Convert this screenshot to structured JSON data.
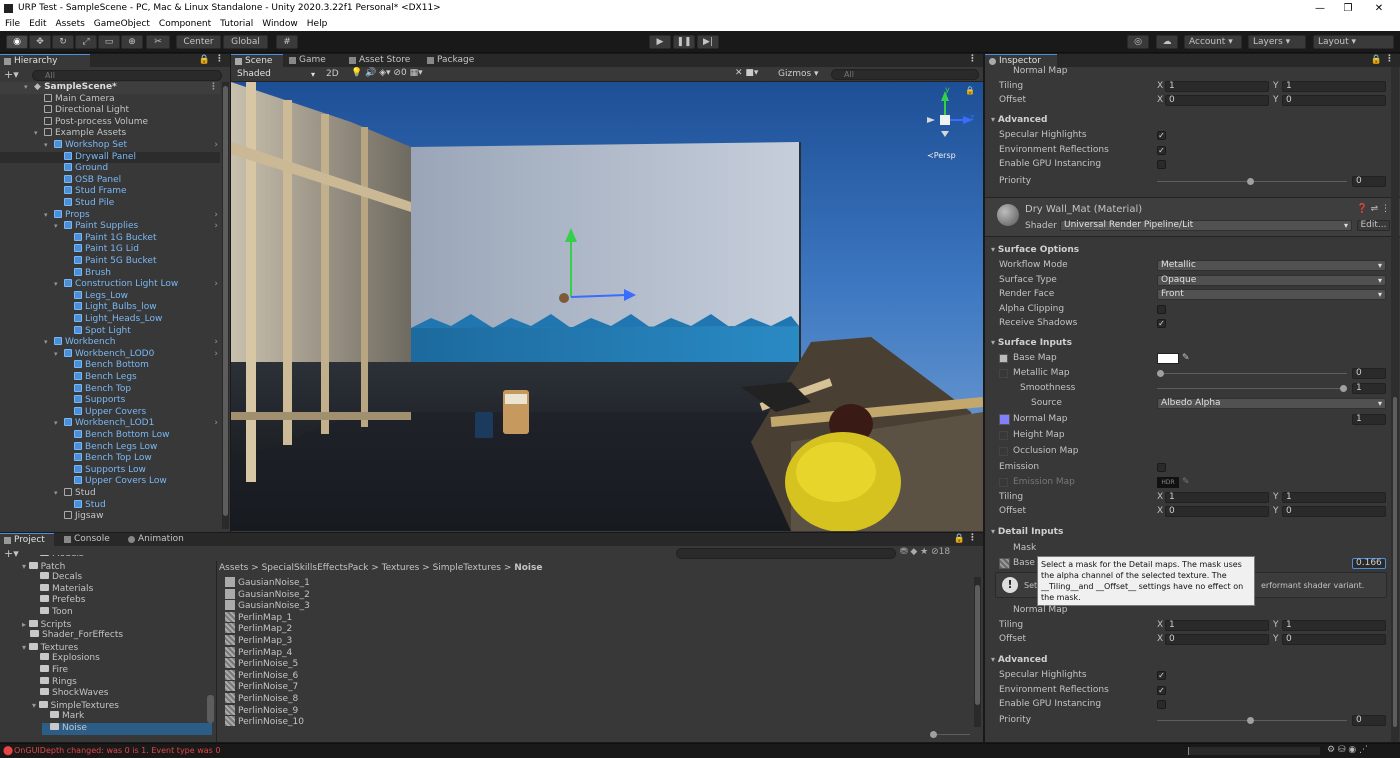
{
  "window": {
    "title": "URP Test - SampleScene - PC, Mac & Linux Standalone - Unity 2020.3.22f1 Personal* <DX11>",
    "minimize": "—",
    "restore": "❐",
    "close": "✕"
  },
  "menu": [
    "File",
    "Edit",
    "Assets",
    "GameObject",
    "Component",
    "Tutorial",
    "Window",
    "Help"
  ],
  "toolbar": {
    "center": "Center",
    "global": "Global",
    "account": "Account",
    "layers": "Layers",
    "layout": "Layout"
  },
  "hierarchy": {
    "tab": "Hierarchy",
    "search_placeholder": "All",
    "rows": [
      {
        "label": "SampleScene*",
        "indent": 0,
        "kind": "scene",
        "expanded": true
      },
      {
        "label": "Main Camera",
        "indent": 1,
        "kind": "go"
      },
      {
        "label": "Directional Light",
        "indent": 1,
        "kind": "go"
      },
      {
        "label": "Post-process Volume",
        "indent": 1,
        "kind": "go"
      },
      {
        "label": "Example Assets",
        "indent": 1,
        "kind": "go",
        "expanded": true
      },
      {
        "label": "Workshop Set",
        "indent": 2,
        "kind": "prefab",
        "expanded": true,
        "more": true
      },
      {
        "label": "Drywall Panel",
        "indent": 3,
        "kind": "prefab",
        "selected": true
      },
      {
        "label": "Ground",
        "indent": 3,
        "kind": "prefab"
      },
      {
        "label": "OSB Panel",
        "indent": 3,
        "kind": "prefab"
      },
      {
        "label": "Stud Frame",
        "indent": 3,
        "kind": "prefab"
      },
      {
        "label": "Stud Pile",
        "indent": 3,
        "kind": "prefab"
      },
      {
        "label": "Props",
        "indent": 2,
        "kind": "prefab",
        "expanded": true,
        "more": true
      },
      {
        "label": "Paint Supplies",
        "indent": 3,
        "kind": "prefab",
        "expanded": true,
        "more": true
      },
      {
        "label": "Paint 1G Bucket",
        "indent": 4,
        "kind": "prefab"
      },
      {
        "label": "Paint 1G Lid",
        "indent": 4,
        "kind": "prefab"
      },
      {
        "label": "Paint 5G Bucket",
        "indent": 4,
        "kind": "prefab"
      },
      {
        "label": "Brush",
        "indent": 4,
        "kind": "prefab"
      },
      {
        "label": "Construction Light Low",
        "indent": 3,
        "kind": "prefab",
        "expanded": true,
        "more": true
      },
      {
        "label": "Legs_Low",
        "indent": 4,
        "kind": "prefab"
      },
      {
        "label": "Light_Bulbs_low",
        "indent": 4,
        "kind": "prefab"
      },
      {
        "label": "Light_Heads_Low",
        "indent": 4,
        "kind": "prefab"
      },
      {
        "label": "Spot Light",
        "indent": 4,
        "kind": "prefab"
      },
      {
        "label": "Workbench",
        "indent": 2,
        "kind": "prefab",
        "expanded": true,
        "more": true
      },
      {
        "label": "Workbench_LOD0",
        "indent": 3,
        "kind": "prefab",
        "expanded": true,
        "more": true
      },
      {
        "label": "Bench Bottom",
        "indent": 4,
        "kind": "prefab"
      },
      {
        "label": "Bench Legs",
        "indent": 4,
        "kind": "prefab"
      },
      {
        "label": "Bench Top",
        "indent": 4,
        "kind": "prefab"
      },
      {
        "label": "Supports",
        "indent": 4,
        "kind": "prefab"
      },
      {
        "label": "Upper Covers",
        "indent": 4,
        "kind": "prefab"
      },
      {
        "label": "Workbench_LOD1",
        "indent": 3,
        "kind": "prefab",
        "expanded": true,
        "more": true
      },
      {
        "label": "Bench Bottom Low",
        "indent": 4,
        "kind": "prefab"
      },
      {
        "label": "Bench Legs Low",
        "indent": 4,
        "kind": "prefab"
      },
      {
        "label": "Bench Top Low",
        "indent": 4,
        "kind": "prefab"
      },
      {
        "label": "Supports Low",
        "indent": 4,
        "kind": "prefab"
      },
      {
        "label": "Upper Covers Low",
        "indent": 4,
        "kind": "prefab"
      },
      {
        "label": "Stud",
        "indent": 3,
        "kind": "go",
        "expanded": true
      },
      {
        "label": "Stud",
        "indent": 4,
        "kind": "prefab"
      },
      {
        "label": "Jigsaw",
        "indent": 3,
        "kind": "go"
      }
    ]
  },
  "scene": {
    "tabs": [
      "Scene",
      "Game",
      "Asset Store",
      "Package Manager"
    ],
    "shading": "Shaded",
    "mode2d": "2D",
    "gizmos": "Gizmos",
    "search_placeholder": "All",
    "axis_y": "y",
    "axis_z": "z",
    "persp": "≺Persp",
    "count": "0"
  },
  "inspector": {
    "tab": "Inspector",
    "top": {
      "normal_map": "Normal Map",
      "tiling": "Tiling",
      "offset": "Offset",
      "tiling_x": "1",
      "tiling_y": "1",
      "offset_x": "0",
      "offset_y": "0",
      "advanced": "Advanced",
      "spec": "Specular Highlights",
      "env": "Environment Reflections",
      "gpu": "Enable GPU Instancing",
      "priority": "Priority",
      "priority_val": "0"
    },
    "material": {
      "name": "Dry Wall_Mat (Material)",
      "shader_label": "Shader",
      "shader": "Universal Render Pipeline/Lit",
      "edit": "Edit..."
    },
    "surface_options": {
      "title": "Surface Options",
      "workflow": "Workflow Mode",
      "workflow_val": "Metallic",
      "surface": "Surface Type",
      "surface_val": "Opaque",
      "render_face": "Render Face",
      "render_face_val": "Front",
      "alpha": "Alpha Clipping",
      "receive": "Receive Shadows"
    },
    "surface_inputs": {
      "title": "Surface Inputs",
      "base_map": "Base Map",
      "metallic_map": "Metallic Map",
      "metallic_val": "0",
      "smoothness": "Smoothness",
      "smoothness_val": "1",
      "source": "Source",
      "source_val": "Albedo Alpha",
      "normal_map": "Normal Map",
      "normal_val": "1",
      "height": "Height Map",
      "occlusion": "Occlusion Map",
      "emission": "Emission",
      "emission_map": "Emission Map",
      "hdr": "HDR",
      "tiling": "Tiling",
      "offset": "Offset",
      "tiling_x": "1",
      "tiling_y": "1",
      "offset_x": "0",
      "offset_y": "0"
    },
    "detail_inputs": {
      "title": "Detail Inputs",
      "mask": "Mask",
      "base": "Base",
      "base_val": "0.166",
      "info_prefix": "Set",
      "info_suffix": "erformant shader variant.",
      "tooltip": "Select a mask for the Detail maps. The mask uses the alpha channel of the selected texture. The __Tiling__and __Offset__ settings have no effect on the mask.",
      "normal_map": "Normal Map",
      "tiling": "Tiling",
      "offset": "Offset",
      "tiling_x": "1",
      "tiling_y": "1",
      "offset_x": "0",
      "offset_y": "0"
    },
    "advanced": {
      "title": "Advanced",
      "spec": "Specular Highlights",
      "env": "Environment Reflections",
      "gpu": "Enable GPU Instancing",
      "priority": "Priority",
      "priority_val": "0"
    }
  },
  "project": {
    "tabs": [
      "Project",
      "Console",
      "Animation"
    ],
    "breadcrumb": [
      "Assets",
      "SpecialSkillsEffectsPack",
      "Textures",
      "SimpleTextures",
      "Noise"
    ],
    "count": "18",
    "folders": [
      {
        "label": "Models",
        "indent": 2
      },
      {
        "label": "Patch",
        "indent": 1,
        "arrow": "▾"
      },
      {
        "label": "Decals",
        "indent": 2
      },
      {
        "label": "Materials",
        "indent": 2
      },
      {
        "label": "Prefebs",
        "indent": 2
      },
      {
        "label": "Toon",
        "indent": 2
      },
      {
        "label": "Scripts",
        "indent": 1,
        "arrow": "▸"
      },
      {
        "label": "Shader_ForEffects",
        "indent": 1
      },
      {
        "label": "Textures",
        "indent": 1,
        "arrow": "▾"
      },
      {
        "label": "Explosions",
        "indent": 2
      },
      {
        "label": "Fire",
        "indent": 2
      },
      {
        "label": "Rings",
        "indent": 2
      },
      {
        "label": "ShockWaves",
        "indent": 2
      },
      {
        "label": "SimpleTextures",
        "indent": 2,
        "arrow": "▾"
      },
      {
        "label": "Mark",
        "indent": 3
      },
      {
        "label": "Noise",
        "indent": 3,
        "selected": true
      }
    ],
    "files": [
      "GausianNoise_1",
      "GausianNoise_2",
      "GausianNoise_3",
      "PerlinMap_1",
      "PerlinMap_2",
      "PerlinMap_3",
      "PerlinMap_4",
      "PerlinNoise_5",
      "PerlinNoise_6",
      "PerlinNoise_7",
      "PerlinNoise_8",
      "PerlinNoise_9",
      "PerlinNoise_10"
    ]
  },
  "status": {
    "message": "OnGUIDepth changed: was 0 is 1. Event type was 0"
  }
}
